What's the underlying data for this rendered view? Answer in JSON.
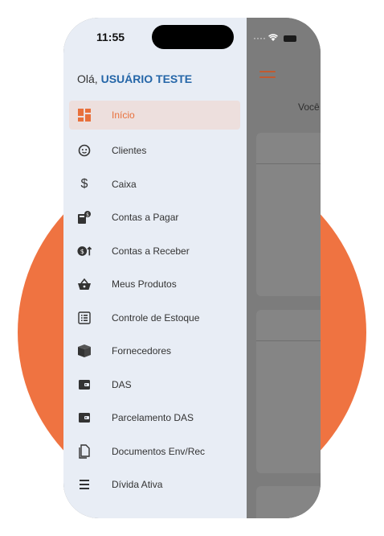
{
  "status": {
    "time": "11:55"
  },
  "greeting": {
    "prefix": "Olá,",
    "user": "USUÁRIO TESTE"
  },
  "menu": [
    {
      "label": "Início",
      "icon": "dashboard-icon",
      "active": true
    },
    {
      "label": "Clientes",
      "icon": "smiley-face-icon"
    },
    {
      "label": "Caixa",
      "icon": "dollar-icon"
    },
    {
      "label": "Contas a Pagar",
      "icon": "calculator-dollar-icon"
    },
    {
      "label": "Contas a Receber",
      "icon": "dollar-up-arrow-icon"
    },
    {
      "label": "Meus Produtos",
      "icon": "basket-icon"
    },
    {
      "label": "Controle de Estoque",
      "icon": "list-icon"
    },
    {
      "label": "Fornecedores",
      "icon": "box-icon"
    },
    {
      "label": "DAS",
      "icon": "wallet-icon"
    },
    {
      "label": "Parcelamento DAS",
      "icon": "wallet-icon"
    },
    {
      "label": "Documentos Env/Rec",
      "icon": "documents-icon"
    },
    {
      "label": "Dívida Ativa",
      "icon": "list-icon"
    }
  ],
  "background": {
    "partial_text": "Você"
  },
  "colors": {
    "accent": "#EF7341",
    "drawer_bg": "#E8EDF5",
    "user_name": "#2566A8",
    "active_bg": "#EDDFDD"
  }
}
